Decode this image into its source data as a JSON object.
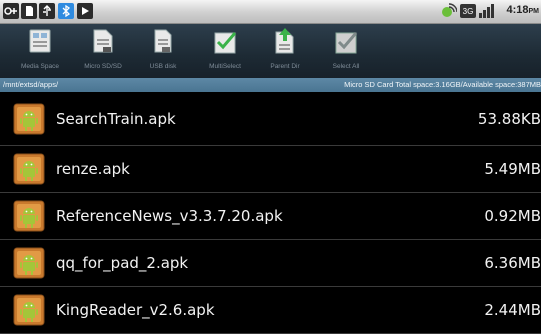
{
  "status_bar": {
    "time": "4:18",
    "ampm": "PM"
  },
  "toolbar": {
    "items": [
      {
        "label": "Media Space",
        "icon": "media-space-icon"
      },
      {
        "label": "Micro SD/SD",
        "icon": "sd-card-icon"
      },
      {
        "label": "USB disk",
        "icon": "usb-disk-icon"
      },
      {
        "label": "MultiSelect",
        "icon": "multiselect-check-icon"
      },
      {
        "label": "Parent Dir",
        "icon": "parent-dir-up-arrow-icon"
      },
      {
        "label": "Select All",
        "icon": "select-all-check-icon"
      }
    ]
  },
  "path_bar": {
    "path": "/mnt/extsd/apps/",
    "storage_info": "Micro SD Card Total space:3.16GB/Available space:387MB"
  },
  "files": [
    {
      "name": "SearchTrain.apk",
      "size": "53.88KB"
    },
    {
      "name": "renze.apk",
      "size": "5.49MB"
    },
    {
      "name": "ReferenceNews_v3.3.7.20.apk",
      "size": "0.92MB"
    },
    {
      "name": "qq_for_pad_2.apk",
      "size": "6.36MB"
    },
    {
      "name": "KingReader_v2.6.apk",
      "size": "2.44MB"
    }
  ],
  "colors": {
    "apk_icon_body": "#c97a2e",
    "android_green": "#a4c639",
    "toolbar_label": "#7f8c98",
    "path_bar": "#5d88a5"
  }
}
